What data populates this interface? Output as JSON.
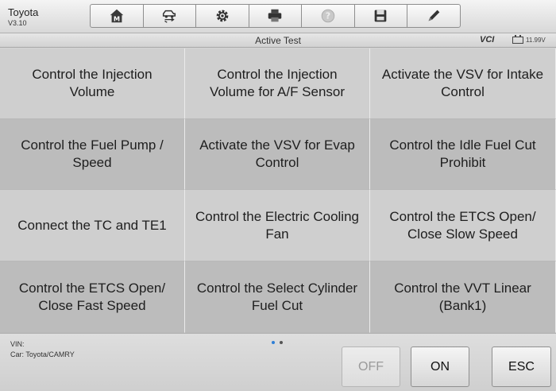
{
  "header": {
    "make": "Toyota",
    "version": "V3.10"
  },
  "toolbar": [
    {
      "name": "home-icon"
    },
    {
      "name": "vehicle-swap-icon"
    },
    {
      "name": "settings-gear-icon"
    },
    {
      "name": "printer-icon"
    },
    {
      "name": "help-icon",
      "disabled": true
    },
    {
      "name": "save-icon"
    },
    {
      "name": "edit-pen-icon"
    }
  ],
  "titlebar": {
    "title": "Active Test",
    "vci": "VCI",
    "voltage": "11.99V"
  },
  "tests": [
    "Control the Injection Volume",
    "Control the Injection Volume for A/F Sensor",
    "Activate the VSV for Intake Control",
    "Control the Fuel Pump / Speed",
    "Activate the VSV for Evap Control",
    "Control the Idle Fuel Cut Prohibit",
    "Connect the TC and TE1",
    "Control the Electric Cooling Fan",
    "Control the ETCS Open/ Close Slow Speed",
    "Control the ETCS Open/ Close Fast Speed",
    "Control the Select Cylinder Fuel Cut",
    "Control the VVT Linear (Bank1)"
  ],
  "footer": {
    "vin_label": "VIN:",
    "car_label": "Car: Toyota/CAMRY",
    "page_count": 2,
    "current_page": 1,
    "off_label": "OFF",
    "on_label": "ON",
    "esc_label": "ESC"
  },
  "colors": {
    "accent_dot": "#2f7fd6",
    "cell_light": "#cfcfcf",
    "cell_dark": "#bcbcbc"
  }
}
